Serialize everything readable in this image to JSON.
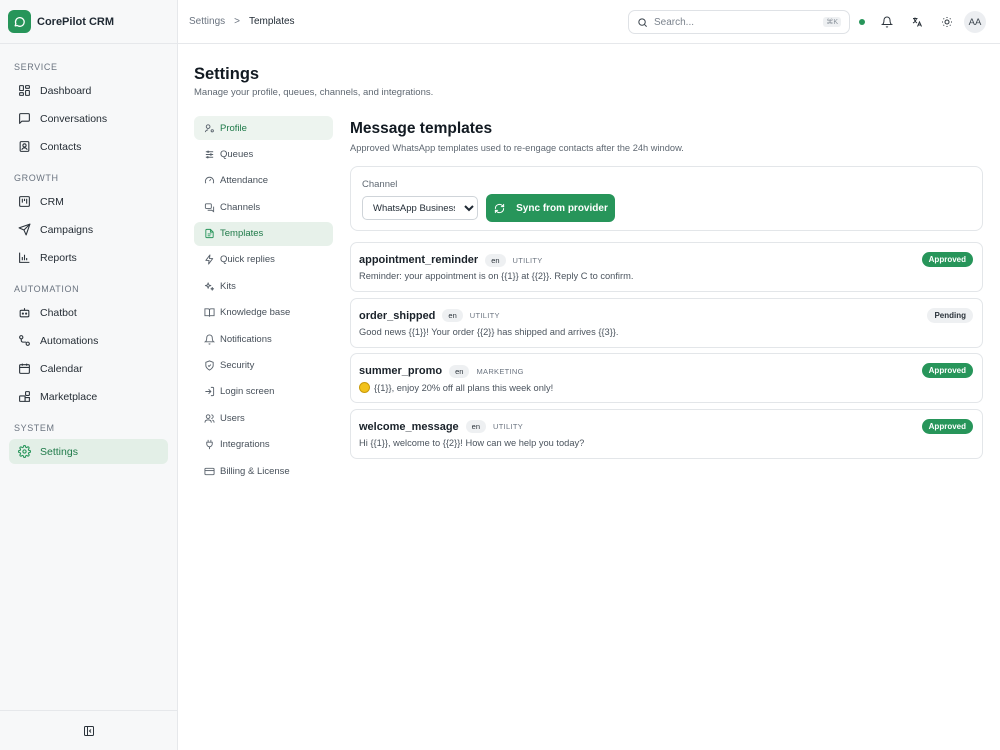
{
  "app": {
    "name": "CorePilot CRM"
  },
  "sidebar": {
    "sections": [
      {
        "title": "SERVICE",
        "items": [
          {
            "label": "Dashboard",
            "icon": "dashboard-icon"
          },
          {
            "label": "Conversations",
            "icon": "chat-icon"
          },
          {
            "label": "Contacts",
            "icon": "contacts-icon"
          }
        ]
      },
      {
        "title": "GROWTH",
        "items": [
          {
            "label": "CRM",
            "icon": "kanban-icon"
          },
          {
            "label": "Campaigns",
            "icon": "send-icon"
          },
          {
            "label": "Reports",
            "icon": "bar-chart-icon"
          }
        ]
      },
      {
        "title": "AUTOMATION",
        "items": [
          {
            "label": "Chatbot",
            "icon": "bot-icon"
          },
          {
            "label": "Automations",
            "icon": "workflow-icon"
          },
          {
            "label": "Calendar",
            "icon": "calendar-icon"
          },
          {
            "label": "Marketplace",
            "icon": "blocks-icon"
          }
        ]
      },
      {
        "title": "SYSTEM",
        "items": [
          {
            "label": "Settings",
            "icon": "gear-icon",
            "active": true
          }
        ]
      }
    ]
  },
  "breadcrumb": {
    "parent": "Settings",
    "separator": ">",
    "current": "Templates"
  },
  "search": {
    "placeholder": "Search...",
    "shortcut": "⌘K"
  },
  "user": {
    "initials": "AA"
  },
  "page": {
    "title": "Settings",
    "subtitle": "Manage your profile, queues, channels, and integrations."
  },
  "settings_nav": [
    {
      "label": "Profile",
      "icon": "user-cog-icon"
    },
    {
      "label": "Queues",
      "icon": "sliders-icon"
    },
    {
      "label": "Attendance",
      "icon": "gauge-icon"
    },
    {
      "label": "Channels",
      "icon": "channels-icon"
    },
    {
      "label": "Templates",
      "icon": "file-text-icon",
      "active": true
    },
    {
      "label": "Quick replies",
      "icon": "zap-icon"
    },
    {
      "label": "Kits",
      "icon": "sparkles-icon"
    },
    {
      "label": "Knowledge base",
      "icon": "book-icon"
    },
    {
      "label": "Notifications",
      "icon": "bell-icon"
    },
    {
      "label": "Security",
      "icon": "shield-icon"
    },
    {
      "label": "Login screen",
      "icon": "login-icon"
    },
    {
      "label": "Users",
      "icon": "users-icon"
    },
    {
      "label": "Integrations",
      "icon": "plug-icon"
    },
    {
      "label": "Billing & License",
      "icon": "credit-card-icon"
    }
  ],
  "templates_panel": {
    "title": "Message templates",
    "subtitle": "Approved WhatsApp templates used to re-engage contacts after the 24h window.",
    "channel_label": "Channel",
    "channel_value": "WhatsApp Business",
    "sync_label": "Sync from provider"
  },
  "templates": [
    {
      "name": "appointment_reminder",
      "lang": "en",
      "category": "UTILITY",
      "body": "Reminder: your appointment is on {{1}} at {{2}}. Reply C to confirm.",
      "status": "Approved",
      "emoji": false
    },
    {
      "name": "order_shipped",
      "lang": "en",
      "category": "UTILITY",
      "body": "Good news {{1}}! Your order {{2}} has shipped and arrives {{3}}.",
      "status": "Pending",
      "emoji": false
    },
    {
      "name": "summer_promo",
      "lang": "en",
      "category": "MARKETING",
      "body": "{{1}}, enjoy 20% off all plans this week only!",
      "status": "Approved",
      "emoji": true
    },
    {
      "name": "welcome_message",
      "lang": "en",
      "category": "UTILITY",
      "body": "Hi {{1}}, welcome to {{2}}! How can we help you today?",
      "status": "Approved",
      "emoji": false
    }
  ],
  "colors": {
    "accent": "#27955a",
    "active_bg": "#e3efe7",
    "pending_bg": "#eef0f2"
  }
}
